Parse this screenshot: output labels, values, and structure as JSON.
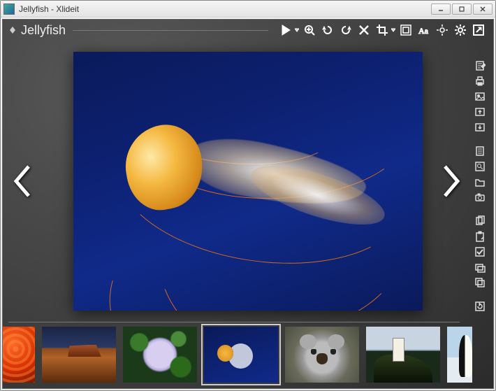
{
  "window": {
    "title": "Jellyfish - Xlideit"
  },
  "topbar": {
    "image_name": "Jellyfish",
    "buttons": {
      "play": "play-icon",
      "play_menu": "dropdown-icon",
      "zoom_in": "zoom-in-icon",
      "rotate_ccw": "rotate-ccw-icon",
      "rotate_cw": "rotate-cw-icon",
      "delete": "delete-icon",
      "crop": "crop-icon",
      "crop_menu": "dropdown-icon",
      "actual_size": "resize-icon",
      "text": "text-icon",
      "fit": "fit-icon",
      "settings": "settings-icon",
      "fullscreen": "fullscreen-icon"
    }
  },
  "sidebar_groups": [
    [
      "edit-icon",
      "print-icon",
      "image-icon",
      "export-icon",
      "import-icon"
    ],
    [
      "list-icon",
      "find-icon",
      "folder-icon",
      "camera-icon"
    ],
    [
      "copy-icon",
      "paste-icon",
      "check-icon",
      "layers-icon",
      "stack-icon"
    ],
    [
      "refresh-icon"
    ]
  ],
  "thumbnails": [
    {
      "name": "chrysanthemum",
      "style": "th-orange",
      "active": false
    },
    {
      "name": "desert",
      "style": "th-desert",
      "active": false
    },
    {
      "name": "hydrangeas",
      "style": "th-flower",
      "active": false
    },
    {
      "name": "jellyfish",
      "style": "th-jelly",
      "active": true
    },
    {
      "name": "koala",
      "style": "th-koala",
      "active": false
    },
    {
      "name": "lighthouse",
      "style": "th-light",
      "active": false
    },
    {
      "name": "penguins",
      "style": "th-peng",
      "active": false
    }
  ]
}
